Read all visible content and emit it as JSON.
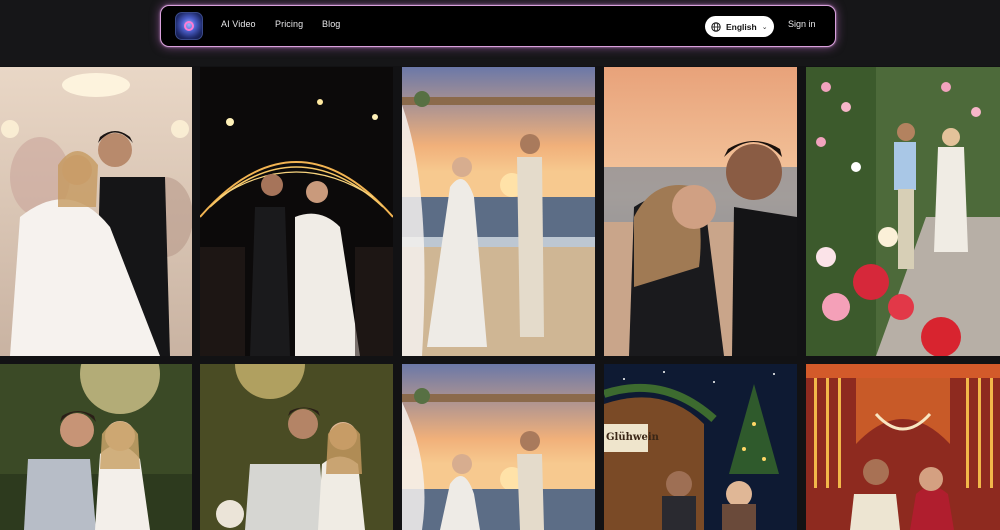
{
  "nav": {
    "logo_icon": "app-logo-icon",
    "links": [
      "AI Video",
      "Pricing",
      "Blog"
    ],
    "language": {
      "label": "English",
      "icon": "globe-icon",
      "caret": "chevron-down-icon"
    },
    "signin_label": "Sign in"
  },
  "gallery": {
    "row1": [
      "bride-groom-ballroom-photo",
      "sparkler-exit-photo",
      "beach-vows-photo",
      "sunset-kiss-photo",
      "rose-garden-photo"
    ],
    "row2": [
      "forest-portrait-photo",
      "golden-hour-photo",
      "beach-vows-photo-2",
      "christmas-market-photo",
      "indian-wedding-photo"
    ],
    "christmas_sign": "Glühwein"
  }
}
